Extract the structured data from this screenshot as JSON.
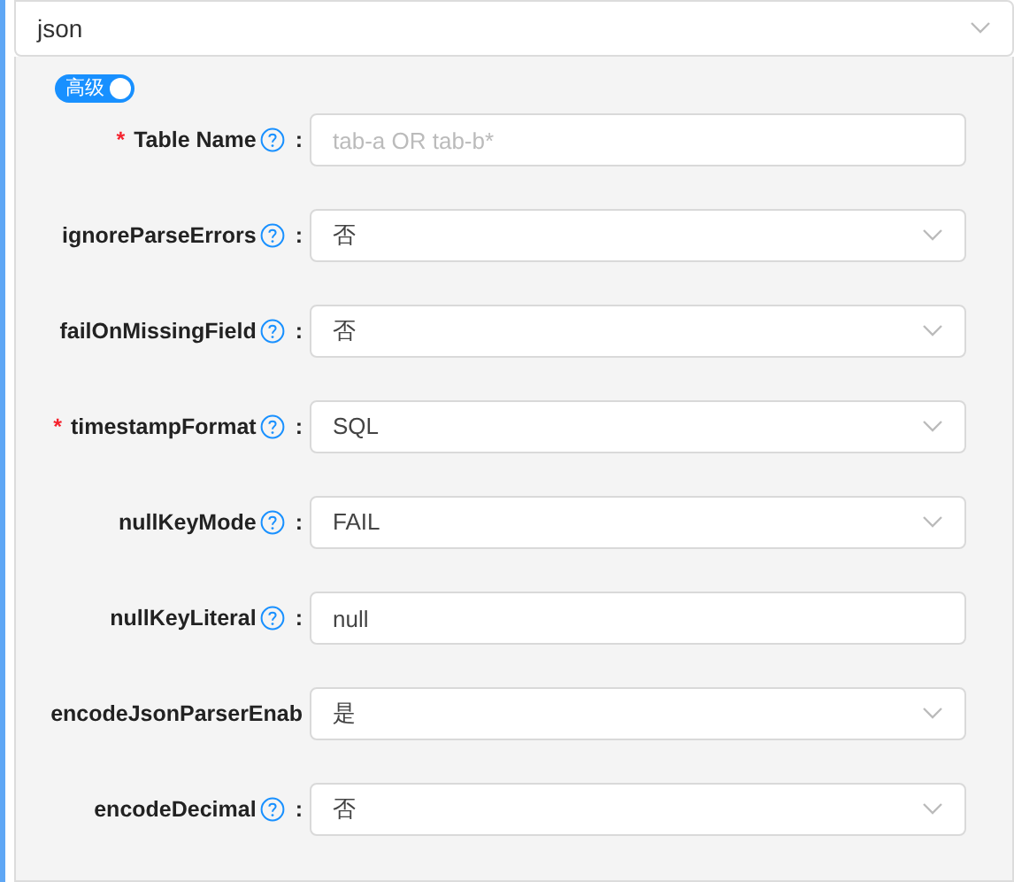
{
  "format_select": {
    "value": "json"
  },
  "advanced_toggle": {
    "label": "高级",
    "on": true
  },
  "fields": [
    {
      "required_mark": "*",
      "label": "Table Name",
      "help": true,
      "colon": ":",
      "kind": "input",
      "placeholder": "tab-a OR tab-b*"
    },
    {
      "label": "ignoreParseErrors",
      "help": true,
      "colon": ":",
      "kind": "select",
      "value": "否"
    },
    {
      "label": "failOnMissingField",
      "help": true,
      "colon": ":",
      "kind": "select",
      "value": "否"
    },
    {
      "required_mark": "*",
      "label": "timestampFormat",
      "help": true,
      "colon": ":",
      "kind": "select",
      "value": "SQL"
    },
    {
      "label": "nullKeyMode",
      "help": true,
      "colon": ":",
      "kind": "select",
      "value": "FAIL"
    },
    {
      "label": "nullKeyLiteral",
      "help": true,
      "colon": ":",
      "kind": "input",
      "value": "null"
    },
    {
      "label": "encodeJsonParserEnab",
      "help": false,
      "kind": "select",
      "value": "是"
    },
    {
      "label": "encodeDecimal",
      "help": true,
      "colon": ":",
      "kind": "select",
      "value": "否"
    }
  ]
}
